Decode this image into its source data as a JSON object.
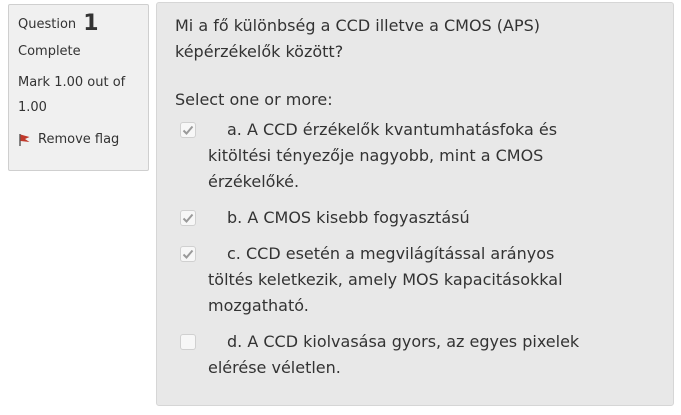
{
  "info": {
    "question_label": "Question",
    "question_number": "1",
    "state": "Complete",
    "grade": "Mark 1.00 out of 1.00",
    "flag_label": "Remove flag"
  },
  "question": {
    "text": "Mi a fő különbség a CCD illetve a CMOS (APS) képérzékelők között?",
    "prompt": "Select one or more:",
    "answers": [
      {
        "label": "a. A CCD érzékelők kvantumhatásfoka és kitöltési tényezője nagyobb, mint a CMOS érzékelőké.",
        "checked": true
      },
      {
        "label": "b. A CMOS kisebb fogyasztású",
        "checked": true
      },
      {
        "label": "c. CCD esetén a megvilágítással arányos töltés keletkezik, amely MOS kapacitásokkal mozgatható.",
        "checked": true
      },
      {
        "label": "d. A CCD kiolvasása gyors, az egyes pixelek elérése véletlen.",
        "checked": false
      }
    ]
  },
  "colors": {
    "flag": "#c0392b",
    "check": "#9a9a9a"
  },
  "icons": {
    "flag": "flag-icon",
    "checkbox": "checkbox-icon"
  }
}
